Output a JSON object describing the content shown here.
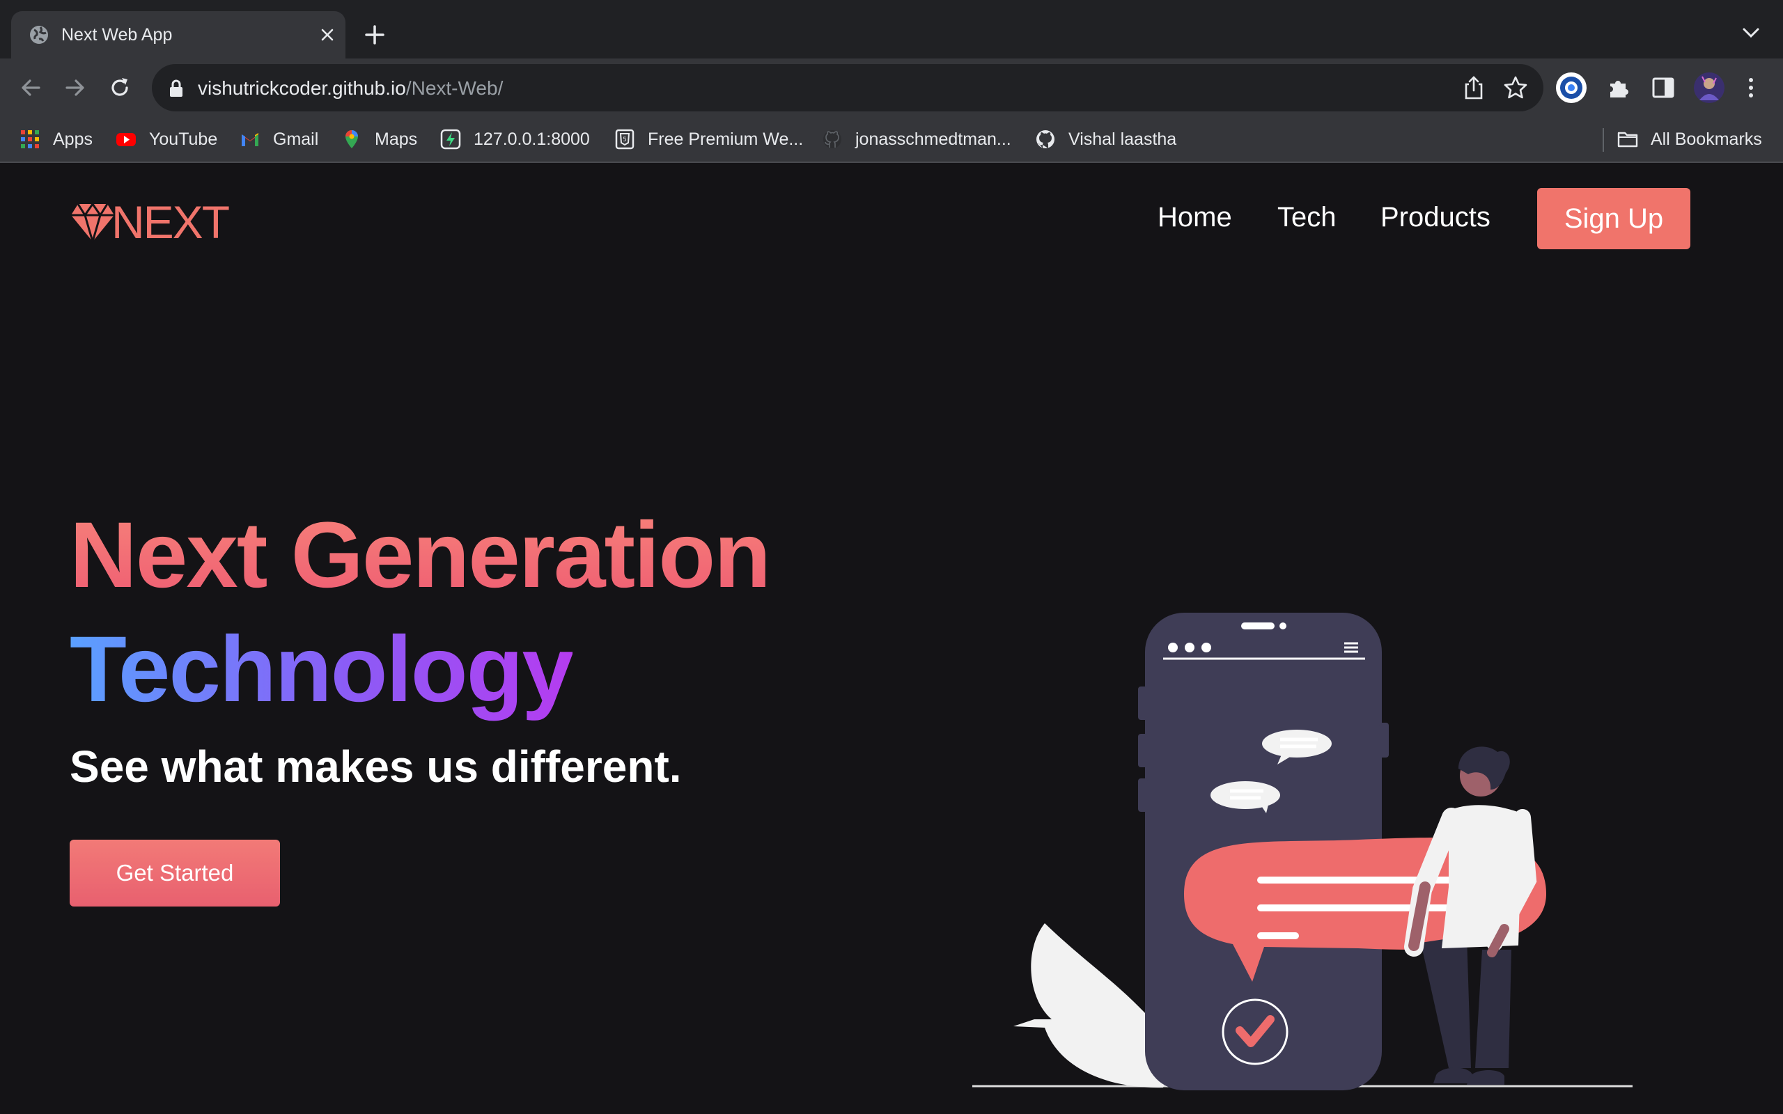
{
  "browser": {
    "tab_title": "Next Web App",
    "url_host": "vishutrickcoder.github.io",
    "url_path": "/Next-Web/",
    "bookmarks": [
      {
        "label": "Apps",
        "icon": "apps-grid-icon"
      },
      {
        "label": "YouTube",
        "icon": "youtube-icon"
      },
      {
        "label": "Gmail",
        "icon": "gmail-icon"
      },
      {
        "label": "Maps",
        "icon": "maps-pin-icon"
      },
      {
        "label": "127.0.0.1:8000",
        "icon": "bolt-icon"
      },
      {
        "label": "Free Premium We...",
        "icon": "html-badge-icon"
      },
      {
        "label": "jonasschmedtman...",
        "icon": "github-icon"
      },
      {
        "label": "Vishal laastha",
        "icon": "github-icon"
      }
    ],
    "all_bookmarks_label": "All Bookmarks"
  },
  "site": {
    "logo_text": "NEXT",
    "nav": [
      "Home",
      "Tech",
      "Products"
    ],
    "signup_label": "Sign Up"
  },
  "hero": {
    "line1": "Next Generation",
    "line2": "Technology",
    "subtitle": "See what makes us different.",
    "cta_label": "Get Started"
  },
  "colors": {
    "accent": "#f0746b",
    "page_bg": "#141316",
    "phone": "#3f3d56",
    "gradient_blue": "#5aa0ff",
    "gradient_purple": "#b53cf0"
  }
}
